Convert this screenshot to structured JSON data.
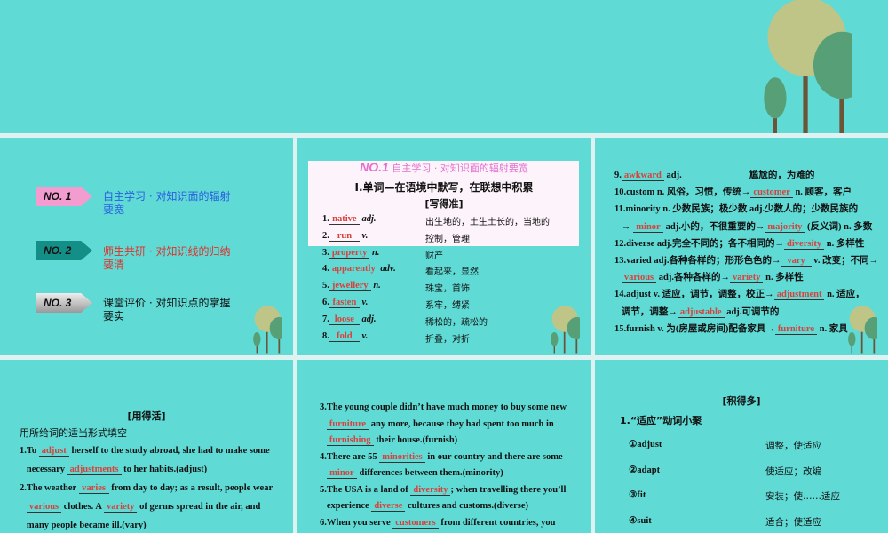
{
  "nav": [
    {
      "badge": "NO. 1",
      "text": "自主学习 · 对知识面的辐射要宽",
      "color": "#2a5fe0",
      "bg": "#f39ccf"
    },
    {
      "badge": "NO. 2",
      "text": "师生共研 · 对知识线的归纳要清",
      "color": "#e0302a",
      "bg": "#138f87"
    },
    {
      "badge": "NO. 3",
      "text": "课堂评价 · 对知识点的掌握要实",
      "color": "#111111",
      "bg": "#c8c8c8"
    }
  ],
  "words": {
    "header_badge": "NO.1",
    "header_title": "自主学习 · 对知识面的辐射要宽",
    "section": "Ⅰ.单词—在语境中默写，在联想中积累",
    "sub": "[写得准]",
    "items": [
      {
        "n": "1.",
        "a": "native",
        "p": "adj.",
        "m": "出生地的，土生土长的，当地的"
      },
      {
        "n": "2.",
        "a": "run",
        "p": "v.",
        "m": "控制，管理"
      },
      {
        "n": "3.",
        "a": "property",
        "p": "n.",
        "m": "财产"
      },
      {
        "n": "4.",
        "a": "apparently",
        "p": "adv.",
        "m": "看起来，显然"
      },
      {
        "n": "5.",
        "a": "jewellery",
        "p": "n.",
        "m": "珠宝，首饰"
      },
      {
        "n": "6.",
        "a": "fasten",
        "p": "v.",
        "m": "系牢，缚紧"
      },
      {
        "n": "7.",
        "a": "loose",
        "p": "adj.",
        "m": "稀松的，疏松的"
      },
      {
        "n": "8.",
        "a": "fold",
        "p": "v.",
        "m": "折叠，对折"
      }
    ]
  },
  "words2": [
    [
      {
        "t": "9."
      },
      {
        "b": "awkward"
      },
      {
        "t": " adj.                             尴尬的，为难的"
      }
    ],
    [
      {
        "t": "10.custom n. 风俗，习惯，传统→"
      },
      {
        "b": "customer"
      },
      {
        "t": " n. 顾客，客户"
      }
    ],
    [
      {
        "t": "11.minority n. 少数民族；极少数 adj.少数人的；少数民族的"
      }
    ],
    [
      {
        "t": "   → "
      },
      {
        "b": "minor"
      },
      {
        "t": " adj.小的，不很重要的→"
      },
      {
        "b": "majority"
      },
      {
        "t": " (反义词) n. 多数"
      }
    ],
    [
      {
        "t": "12.diverse adj.完全不同的；各不相同的→"
      },
      {
        "b": "diversity"
      },
      {
        "t": " n. 多样性"
      }
    ],
    [
      {
        "t": "13.varied adj.各种各样的；形形色色的→"
      },
      {
        "b": "vary"
      },
      {
        "t": " v. 改变；不同→"
      }
    ],
    [
      {
        "t": "   "
      },
      {
        "b": "various"
      },
      {
        "t": " adj.各种各样的→"
      },
      {
        "b": "variety"
      },
      {
        "t": " n. 多样性"
      }
    ],
    [
      {
        "t": "14.adjust v. 适应，调节，调整，校正→"
      },
      {
        "b": "adjustment"
      },
      {
        "t": " n. 适应，"
      }
    ],
    [
      {
        "t": "   调节，调整→"
      },
      {
        "b": "adjustable"
      },
      {
        "t": " adj.可调节的"
      }
    ],
    [
      {
        "t": "15.furnish v. 为(房屋或房间)配备家具→"
      },
      {
        "b": "furniture"
      },
      {
        "t": " n. 家具"
      }
    ]
  ],
  "use": {
    "title": "[用得活]",
    "instr": "用所给词的适当形式填空",
    "lines": [
      [
        {
          "t": "1.To "
        },
        {
          "b": "adjust"
        },
        {
          "t": " herself to the study abroad, she had to make some"
        }
      ],
      [
        {
          "t": "   necessary "
        },
        {
          "b": "adjustments"
        },
        {
          "t": " to her habits.(adjust)"
        }
      ],
      [
        {
          "t": "2.The weather "
        },
        {
          "b": "varies"
        },
        {
          "t": " from day to day; as a result, people wear"
        }
      ],
      [
        {
          "t": "   "
        },
        {
          "b": "various"
        },
        {
          "t": " clothes. A "
        },
        {
          "b": "variety"
        },
        {
          "t": " of germs spread in the air, and"
        }
      ],
      [
        {
          "t": "   many people became ill.(vary)"
        }
      ]
    ]
  },
  "use2": [
    [
      {
        "t": "3.The young couple didn’t have much money to buy some new"
      }
    ],
    [
      {
        "t": "   "
      },
      {
        "b": "furniture"
      },
      {
        "t": " any more, because they had spent too much in"
      }
    ],
    [
      {
        "t": "   "
      },
      {
        "b": "furnishing"
      },
      {
        "t": " their house.(furnish)"
      }
    ],
    [
      {
        "t": "4.There are 55 "
      },
      {
        "b": "minorities"
      },
      {
        "t": " in our country and there are some"
      }
    ],
    [
      {
        "t": "   "
      },
      {
        "b": "minor"
      },
      {
        "t": " differences between them.(minority)"
      }
    ],
    [
      {
        "t": "5.The USA is a land of "
      },
      {
        "b": "diversity"
      },
      {
        "t": "; when travelling there you’ll"
      }
    ],
    [
      {
        "t": "   experience "
      },
      {
        "b": "diverse"
      },
      {
        "t": " cultures and customs.(diverse)"
      }
    ],
    [
      {
        "t": "6.When you serve "
      },
      {
        "b": "customers"
      },
      {
        "t": " from different countries, you"
      }
    ]
  ],
  "more": {
    "title": "[积得多]",
    "sub": "1.“适应”动词小聚",
    "rows": [
      {
        "w": "①adjust",
        "m": "调整，使适应"
      },
      {
        "w": "②adapt",
        "m": "使适应；改编"
      },
      {
        "w": "③fit",
        "m": "安装；使……适应"
      },
      {
        "w": "④suit",
        "m": "适合；使适应"
      }
    ]
  }
}
